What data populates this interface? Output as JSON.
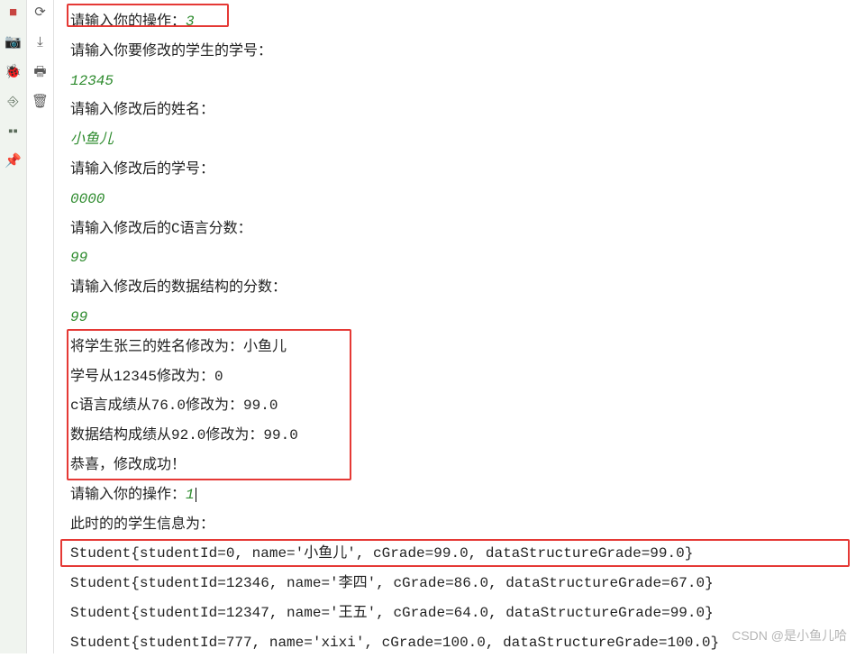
{
  "sidebar_left": {
    "icons": [
      "■",
      "📷",
      "🐞",
      "⎆",
      "▪▪",
      "📌"
    ]
  },
  "sidebar_mid": {
    "icons": [
      "⟳",
      "⤓",
      "🖶",
      "🗑"
    ]
  },
  "console": {
    "l01_prompt": "请输入你的操作：",
    "l01_input": "3",
    "l02": "请输入你要修改的学生的学号：",
    "l03_input": "12345",
    "l04": "请输入修改后的姓名：",
    "l05_input": "小鱼儿",
    "l06": "请输入修改后的学号：",
    "l07_input": "0000",
    "l08": "请输入修改后的C语言分数：",
    "l09_input": "99",
    "l10": "请输入修改后的数据结构的分数：",
    "l11_input": "99",
    "l12": "将学生张三的姓名修改为：小鱼儿",
    "l13": "学号从12345修改为：0",
    "l14": "c语言成绩从76.0修改为：99.0",
    "l15": "数据结构成绩从92.0修改为：99.0",
    "l16": "恭喜，修改成功！",
    "l17_prompt": "请输入你的操作：",
    "l17_input": "1",
    "l18": "此时的的学生信息为：",
    "l19": "Student{studentId=0, name='小鱼儿', cGrade=99.0, dataStructureGrade=99.0}",
    "l20": "Student{studentId=12346, name='李四', cGrade=86.0, dataStructureGrade=67.0}",
    "l21": "Student{studentId=12347, name='王五', cGrade=64.0, dataStructureGrade=99.0}",
    "l22": "Student{studentId=777, name='xixi', cGrade=100.0, dataStructureGrade=100.0}"
  },
  "watermark": "CSDN @是小鱼儿哈"
}
